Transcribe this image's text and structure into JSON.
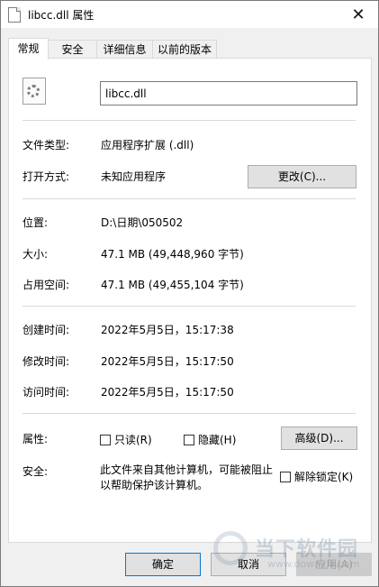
{
  "window": {
    "title": "libcc.dll 属性"
  },
  "tabs": [
    "常规",
    "安全",
    "详细信息",
    "以前的版本"
  ],
  "file": {
    "name": "libcc.dll"
  },
  "rows": {
    "type_label": "文件类型:",
    "type_value": "应用程序扩展 (.dll)",
    "open_label": "打开方式:",
    "open_value": "未知应用程序",
    "change_button": "更改(C)...",
    "location_label": "位置:",
    "location_value": "D:\\日期\\050502",
    "size_label": "大小:",
    "size_value": "47.1 MB (49,448,960 字节)",
    "disk_label": "占用空间:",
    "disk_value": "47.1 MB (49,455,104 字节)",
    "created_label": "创建时间:",
    "created_value": "2022年5月5日，15:17:38",
    "modified_label": "修改时间:",
    "modified_value": "2022年5月5日，15:17:50",
    "accessed_label": "访问时间:",
    "accessed_value": "2022年5月5日，15:17:50",
    "attributes_label": "属性:",
    "readonly_label": "只读(R)",
    "hidden_label": "隐藏(H)",
    "advanced_button": "高级(D)...",
    "security_label": "安全:",
    "security_text": "此文件来自其他计算机，可能被阻止以帮助保护该计算机。",
    "unblock_label": "解除锁定(K)"
  },
  "footer": {
    "ok": "确定",
    "cancel": "取消",
    "apply": "应用(A)"
  },
  "watermark": {
    "text": "当下软件园",
    "sub": "www.downxia.com"
  }
}
